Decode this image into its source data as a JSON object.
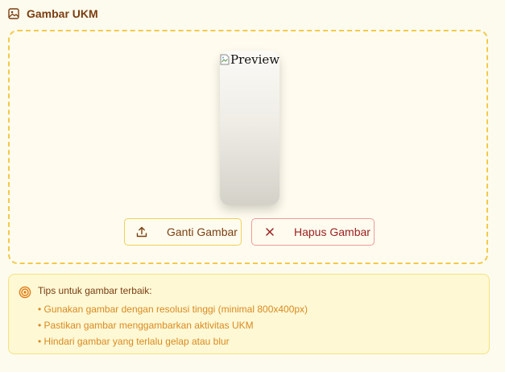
{
  "section": {
    "title": "Gambar UKM",
    "title_icon": "image-icon"
  },
  "preview": {
    "alt_text": "Preview",
    "broken_icon": "broken-image-icon"
  },
  "actions": {
    "change_label": "Ganti Gambar",
    "change_icon": "upload-icon",
    "remove_label": "Hapus Gambar",
    "remove_icon": "close-icon"
  },
  "tips": {
    "icon": "target-icon",
    "title": "Tips untuk gambar terbaik:",
    "items": [
      "• Gunakan gambar dengan resolusi tinggi (minimal 800x400px)",
      "• Pastikan gambar menggambarkan aktivitas UKM",
      "• Hindari gambar yang terlalu gelap atau blur"
    ]
  },
  "colors": {
    "background": "#fdfbee",
    "accent_border": "#f3c94a",
    "title_text": "#7a3e10",
    "danger_text": "#9a1d1d",
    "danger_border": "#ef9a9a",
    "tip_text": "#d98a1f",
    "tip_background": "#fef8d5"
  }
}
